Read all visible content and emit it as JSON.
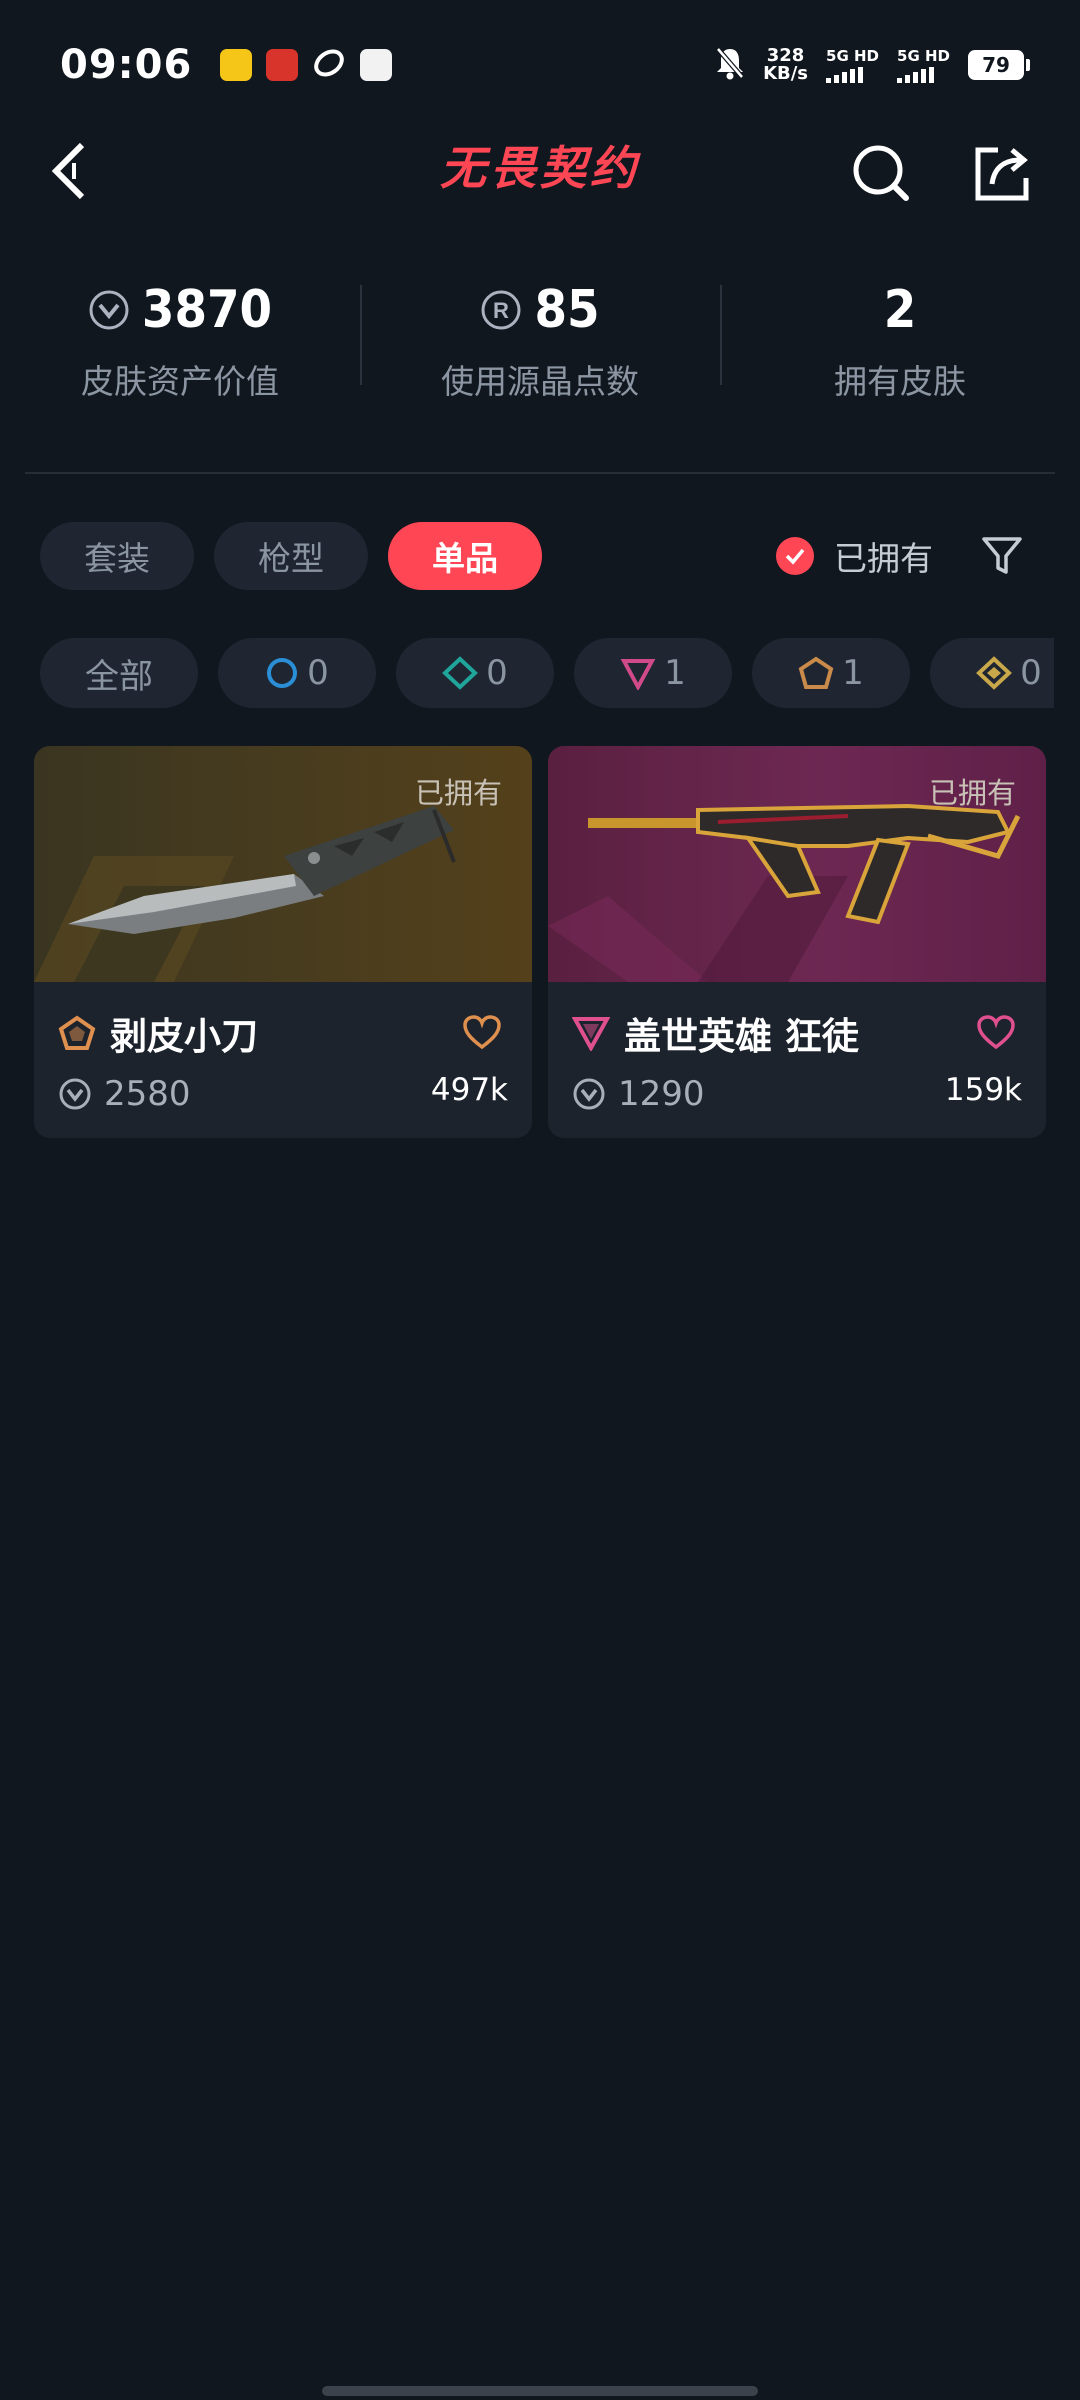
{
  "status_bar": {
    "time": "09:06",
    "net_speed_value": "328",
    "net_speed_unit": "KB/s",
    "sim1": "5G HD",
    "sim2": "5G HD",
    "battery": "79"
  },
  "header": {
    "brand": "无畏契约",
    "icons": [
      "back-icon",
      "search-icon",
      "share-icon"
    ]
  },
  "stats": [
    {
      "value": "3870",
      "label": "皮肤资产价值",
      "icon": "vp-icon"
    },
    {
      "value": "85",
      "label": "使用源晶点数",
      "icon": "radianite-icon"
    },
    {
      "value": "2",
      "label": "拥有皮肤"
    }
  ],
  "tabs": [
    {
      "label": "套装",
      "active": false
    },
    {
      "label": "枪型",
      "active": false
    },
    {
      "label": "单品",
      "active": true
    }
  ],
  "owned_filter": {
    "label": "已拥有",
    "checked": true
  },
  "tiers": [
    {
      "label": "全部"
    },
    {
      "count": "0",
      "icon": "select-tier-icon",
      "color": "#2a8fd6"
    },
    {
      "count": "0",
      "icon": "deluxe-tier-icon",
      "color": "#1fa59a"
    },
    {
      "count": "1",
      "icon": "premium-tier-icon",
      "color": "#d04a8a"
    },
    {
      "count": "1",
      "icon": "exclusive-tier-icon",
      "color": "#c98a4a"
    },
    {
      "count": "0",
      "icon": "ultra-tier-icon",
      "color": "#c8a84a"
    }
  ],
  "cards": [
    {
      "owned_tag": "已拥有",
      "name": "剥皮小刀",
      "price": "2580",
      "favorites": "497k",
      "tier_color": "#e0904e",
      "heart_color": "#e0904e"
    },
    {
      "owned_tag": "已拥有",
      "name": "盖世英雄 狂徒",
      "price": "1290",
      "favorites": "159k",
      "tier_color": "#e0508f",
      "heart_color": "#e0508f"
    }
  ]
}
